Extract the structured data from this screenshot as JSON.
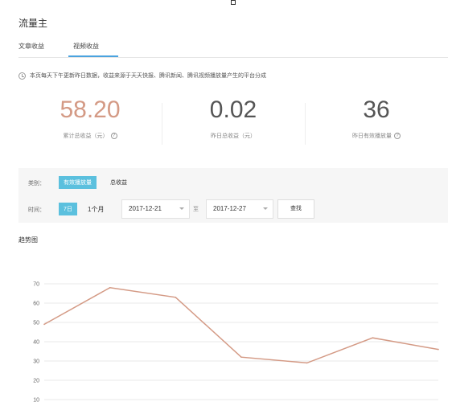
{
  "page": {
    "title": "流量主"
  },
  "tabs": [
    {
      "label": "文章收益"
    },
    {
      "label": "视频收益"
    }
  ],
  "notice": {
    "text": "本页每天下午更新昨日数据，收益来源于天天快报、腾讯新闻、腾讯视频播放量产生的平台分成"
  },
  "stats": [
    {
      "value": "58.20",
      "label": "累计总收益（元）"
    },
    {
      "value": "0.02",
      "label": "昨日总收益（元）"
    },
    {
      "value": "36",
      "label": "昨日有效播放量"
    }
  ],
  "filter": {
    "category_label": "类别：",
    "category_active": "有效播放量",
    "category_other": "总收益",
    "time_label": "时间：",
    "range_7d": "7日",
    "range_1m": "1个月",
    "date_from": "2017-12-21",
    "date_sep": "至",
    "date_to": "2017-12-27",
    "search_button": "查找"
  },
  "trend": {
    "title": "趋势图"
  },
  "colors": {
    "accent": "#d49a85",
    "tab_active": "#4aa3df",
    "chip_active": "#5bc0de"
  },
  "chart_data": {
    "type": "line",
    "title": "",
    "xlabel": "",
    "ylabel": "",
    "y_ticks": [
      10,
      20,
      30,
      40,
      50,
      60,
      70
    ],
    "ylim": [
      10,
      70
    ],
    "grid": true,
    "series": [
      {
        "values": [
          49,
          68,
          63,
          32,
          29,
          42,
          36
        ]
      }
    ]
  }
}
